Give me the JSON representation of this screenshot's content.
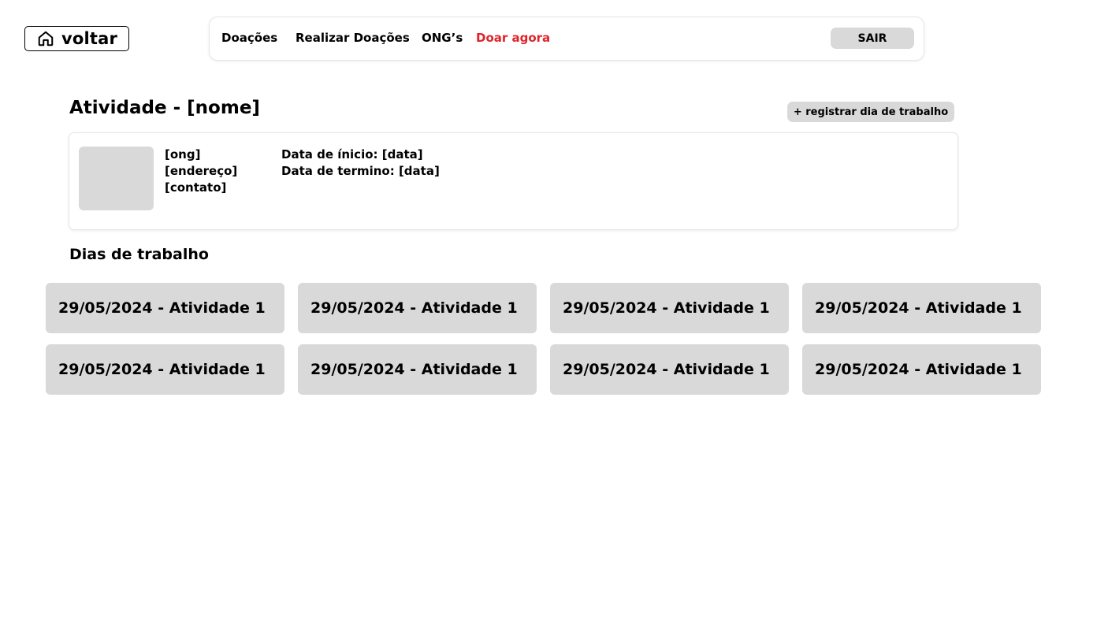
{
  "back": {
    "label": "voltar",
    "icon": "home-icon"
  },
  "nav": {
    "links": [
      "Doações",
      "Realizar Doações",
      "ONG’s",
      "Doar agora"
    ],
    "logout_label": "SAIR",
    "cta_color": "#e0232b"
  },
  "activity": {
    "title": "Atividade - [nome]",
    "register_label": "+ registrar dia de trabalho",
    "ong": "[ong]",
    "address": "[endereço]",
    "contact": "[contato]",
    "start_date": "Data de ínicio: [data]",
    "end_date": "Data de termino: [data]"
  },
  "workdays": {
    "title": "Dias de trabalho",
    "items": [
      "29/05/2024 - Atividade 1",
      "29/05/2024 - Atividade 1",
      "29/05/2024 - Atividade 1",
      "29/05/2024 - Atividade 1",
      "29/05/2024 - Atividade 1",
      "29/05/2024 - Atividade 1",
      "29/05/2024 - Atividade 1",
      "29/05/2024 - Atividade 1"
    ]
  },
  "colors": {
    "card_bg": "#d9d9d9",
    "accent_red": "#e0232b"
  }
}
